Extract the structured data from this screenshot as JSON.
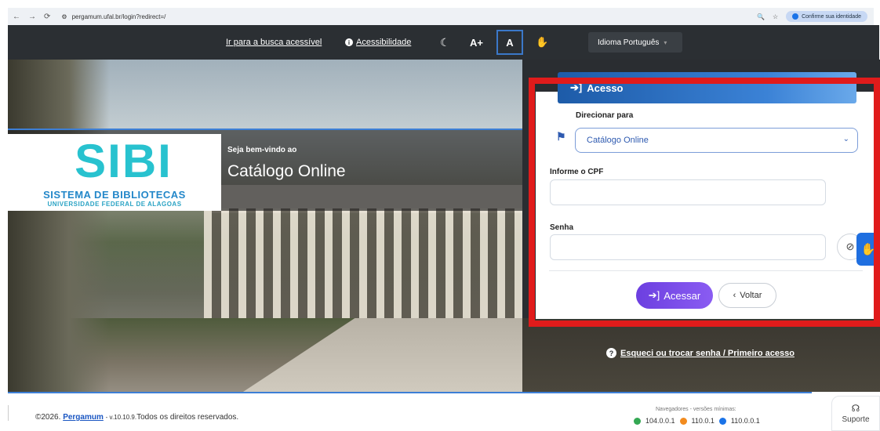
{
  "browser": {
    "url": "pergamum.ufal.br/login?redirect=/",
    "identity_button": "Confirme sua identidade"
  },
  "accessibility_bar": {
    "accessible_search_link": "Ir para a busca acessível",
    "accessibility_link": "Acessibilidade",
    "font_increase": "A+",
    "contrast": "A",
    "language": "Idioma Português"
  },
  "hero": {
    "logo_main": "SIBI",
    "logo_line1": "SISTEMA DE BIBLIOTECAS",
    "logo_line2": "UNIVERSIDADE FEDERAL DE ALAGOAS",
    "welcome": "Seja bem-vindo ao",
    "catalog_title": "Catálogo Online"
  },
  "login": {
    "header": "Acesso",
    "redirect_label": "Direcionar para",
    "redirect_value": "Catálogo Online",
    "cpf_label": "Informe o CPF",
    "cpf_value": "",
    "password_label": "Senha",
    "password_value": "",
    "submit_label": "Acessar",
    "back_label": "Voltar",
    "forgot_link": "Esqueci ou trocar senha / Primeiro acesso"
  },
  "footer": {
    "copyright_prefix": "©2026.",
    "brand_link": "Pergamum",
    "version_text": "- v.10.10.9.",
    "rights": "Todos os direitos reservados.",
    "browsers_title": "Navegadores - versões mínimas:",
    "chrome_version": "104.0.0.1",
    "firefox_version": "110.0.1",
    "edge_version": "110.0.0.1",
    "support_label": "Suporte"
  },
  "colors": {
    "accent_blue": "#3d7fd6",
    "highlight_red": "#e01b1b",
    "primary_purple": "#7a4be8"
  }
}
